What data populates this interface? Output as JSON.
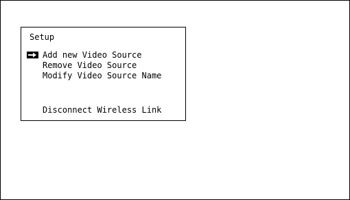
{
  "panel": {
    "title": "Setup"
  },
  "menu": {
    "selected_index": 0,
    "selection_indicator_icon": "right-arrow-icon",
    "items": [
      {
        "label": "Add new Video Source"
      },
      {
        "label": "Remove Video Source"
      },
      {
        "label": "Modify Video Source Name"
      },
      {
        "label": "Disconnect Wireless Link"
      }
    ]
  },
  "colors": {
    "foreground": "#000000",
    "background": "#ffffff"
  }
}
